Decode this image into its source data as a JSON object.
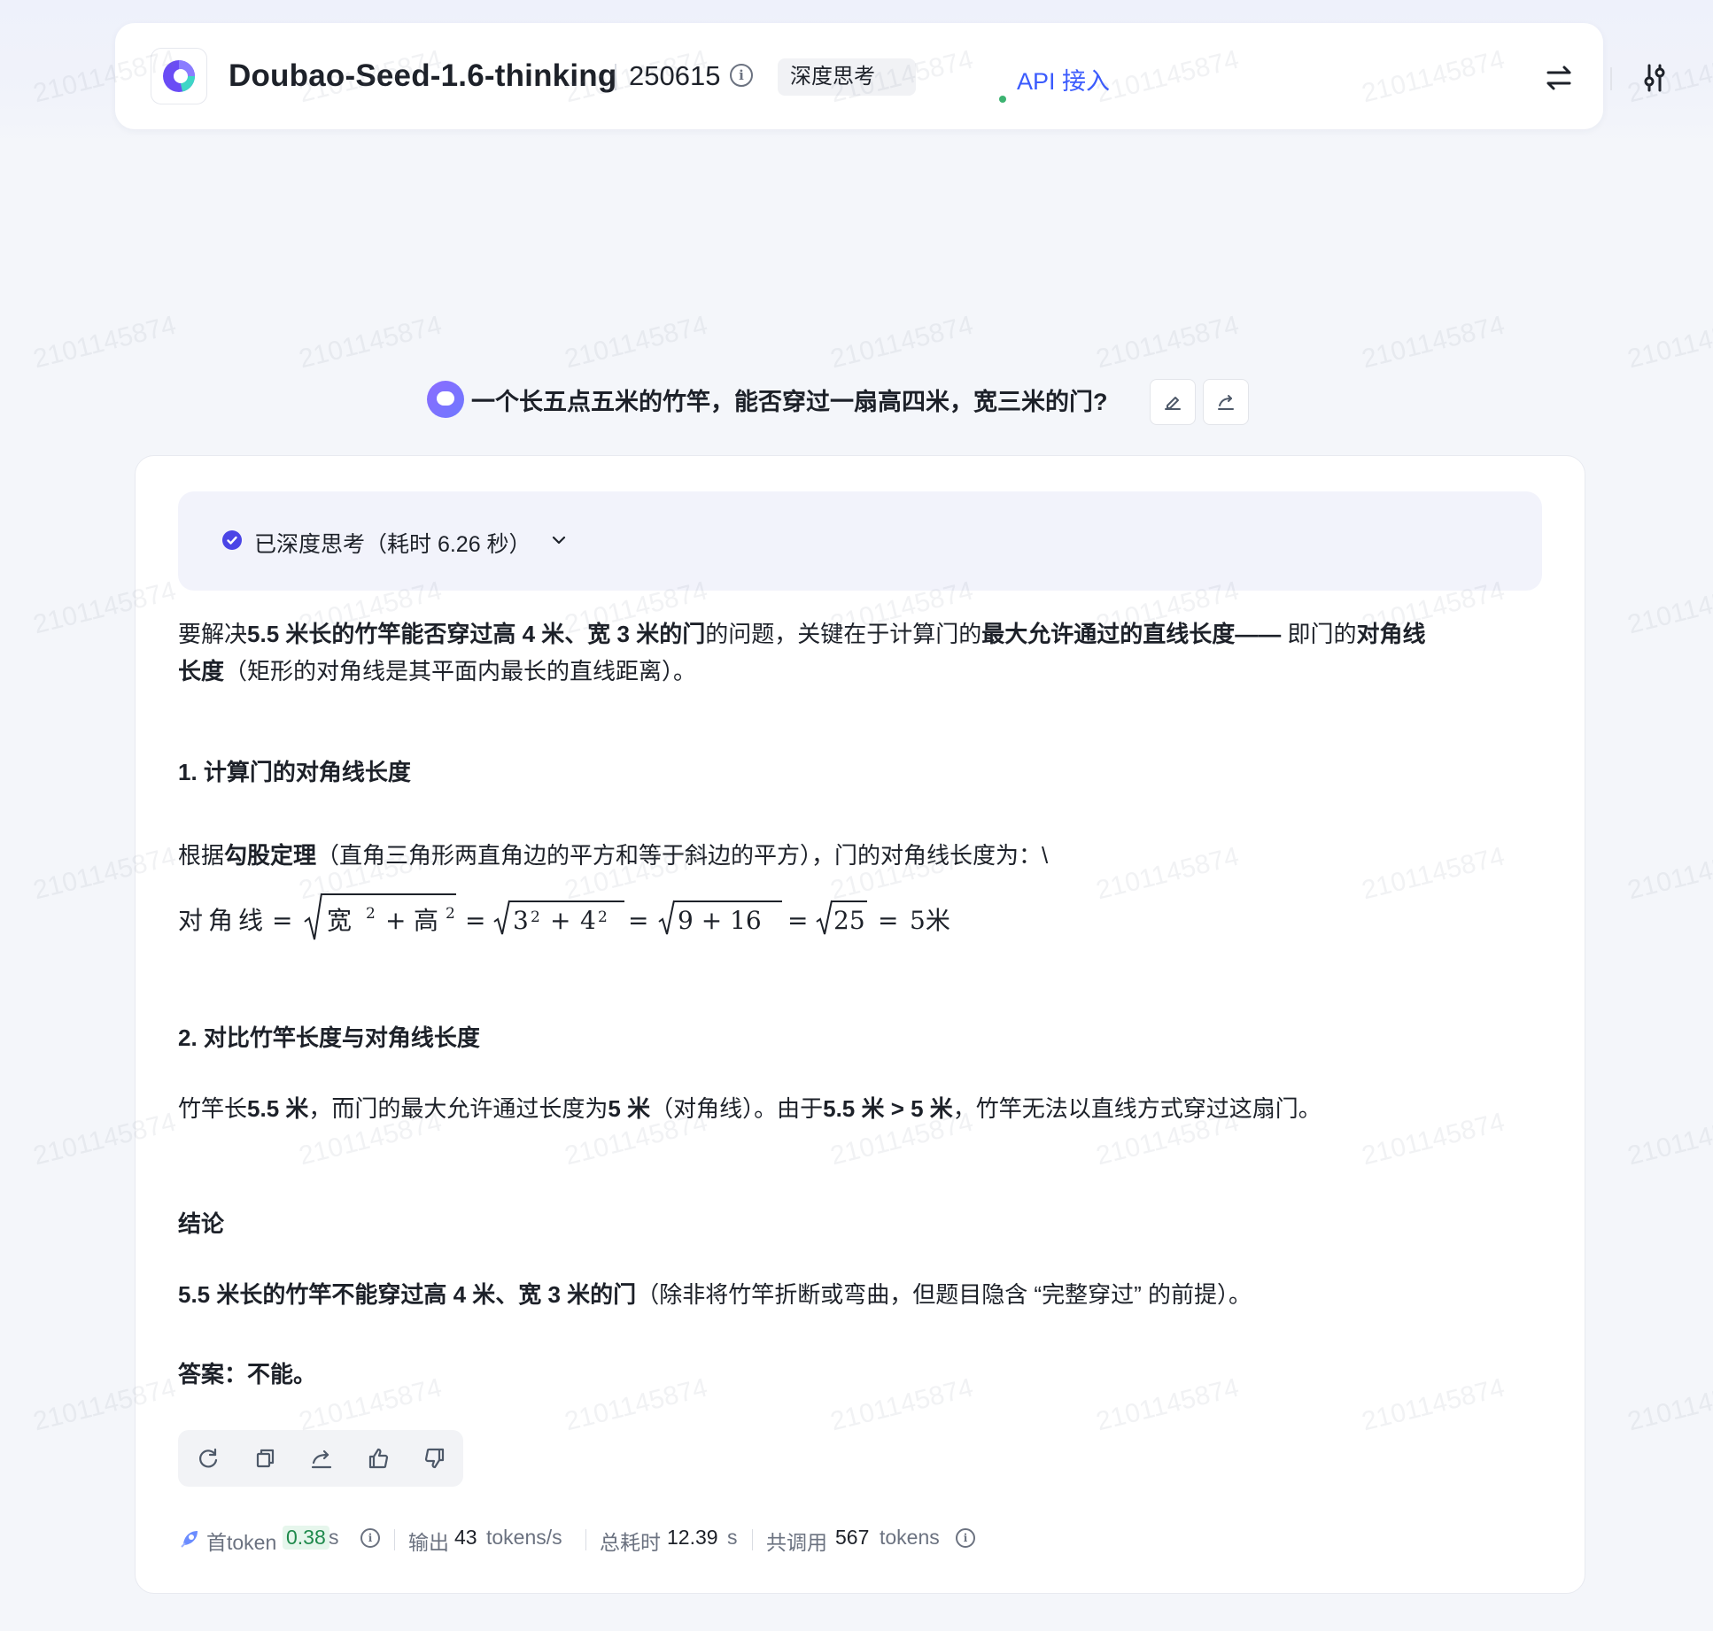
{
  "header": {
    "model_name": "Doubao-Seed-1.6-thinking",
    "model_version": "250615",
    "info_glyph": "i",
    "tag_label": "深度思考",
    "api_link": "API 接入"
  },
  "question": {
    "text": "一个长五点五米的竹竿，能否穿过一扇高四米，宽三米的门?"
  },
  "thinking": {
    "label": "已深度思考（耗时 6.26 秒）"
  },
  "answer": {
    "intro": [
      {
        "t": "要解决",
        "b": false
      },
      {
        "t": "5.5 米长的竹竿能否穿过高 4 米、宽 3 米的门",
        "b": true
      },
      {
        "t": "的问题，关键在于计算门的",
        "b": false
      },
      {
        "t": "最大允许通过的直线长度—— ",
        "b": true
      },
      {
        "t": "即门的",
        "b": false
      },
      {
        "t": "对角线",
        "b": true
      }
    ],
    "intro_line2": [
      {
        "t": "长度",
        "b": true
      },
      {
        "t": "（矩形的对角线是其平面内最长的直线距离）。",
        "b": false
      }
    ],
    "section1_title": "1. 计算门的对角线长度",
    "section1_para": [
      {
        "t": "根据",
        "b": false
      },
      {
        "t": "勾股定理",
        "b": true
      },
      {
        "t": "（直角三角形两直角边的平方和等于斜边的平方），门的对角线长度为：\\",
        "b": false
      }
    ],
    "formula": {
      "lhs": "对角线",
      "eq": "=",
      "w": "宽",
      "h": "高",
      "sq": "2",
      "plus": "+",
      "n3": "3",
      "n4": "4",
      "sum": "9 + 16",
      "n25": "25",
      "result": "5米"
    },
    "section2_title": "2. 对比竹竿长度与对角线长度",
    "section2_para": [
      {
        "t": "竹竿长",
        "b": false
      },
      {
        "t": "5.5 米",
        "b": true
      },
      {
        "t": "，而门的最大允许通过长度为",
        "b": false
      },
      {
        "t": "5 米",
        "b": true
      },
      {
        "t": "（对角线）。由于",
        "b": false
      },
      {
        "t": "5.5 米 > 5 米",
        "b": true
      },
      {
        "t": "，竹竿无法以直线方式穿过这扇门。",
        "b": false
      }
    ],
    "conclusion_title": "结论",
    "conclusion_para": [
      {
        "t": "5.5 米长的竹竿不能穿过高 4 米、宽 3 米的门",
        "b": true
      },
      {
        "t": "（除非将竹竿折断或弯曲，但题目隐含 “完整穿过” 的前提）。",
        "b": false
      }
    ],
    "final_answer": "答案：不能。"
  },
  "stats": {
    "first_token_label": "首token",
    "first_token_value": "0.38",
    "first_token_unit": "s",
    "output_label": "输出",
    "output_value": "43",
    "output_unit": "tokens/s",
    "total_time_label": "总耗时",
    "total_time_value": "12.39",
    "total_time_unit": "s",
    "total_tokens_label": "共调用",
    "total_tokens_value": "567",
    "total_tokens_unit": "tokens"
  },
  "watermark_text": "2101145874",
  "colors": {
    "accent": "#3b5bfd",
    "thinking_check": "#4b45e6",
    "green": "#1f8a4c",
    "tag_dot": "#3cb371"
  },
  "icons": {
    "header_swap": "swap-arrows-icon",
    "header_settings": "sliders-icon",
    "question_edit": "edit-icon",
    "question_share": "share-icon",
    "actions": [
      "refresh-icon",
      "copy-icon",
      "share-icon",
      "thumbs-up-icon",
      "thumbs-down-icon"
    ]
  }
}
